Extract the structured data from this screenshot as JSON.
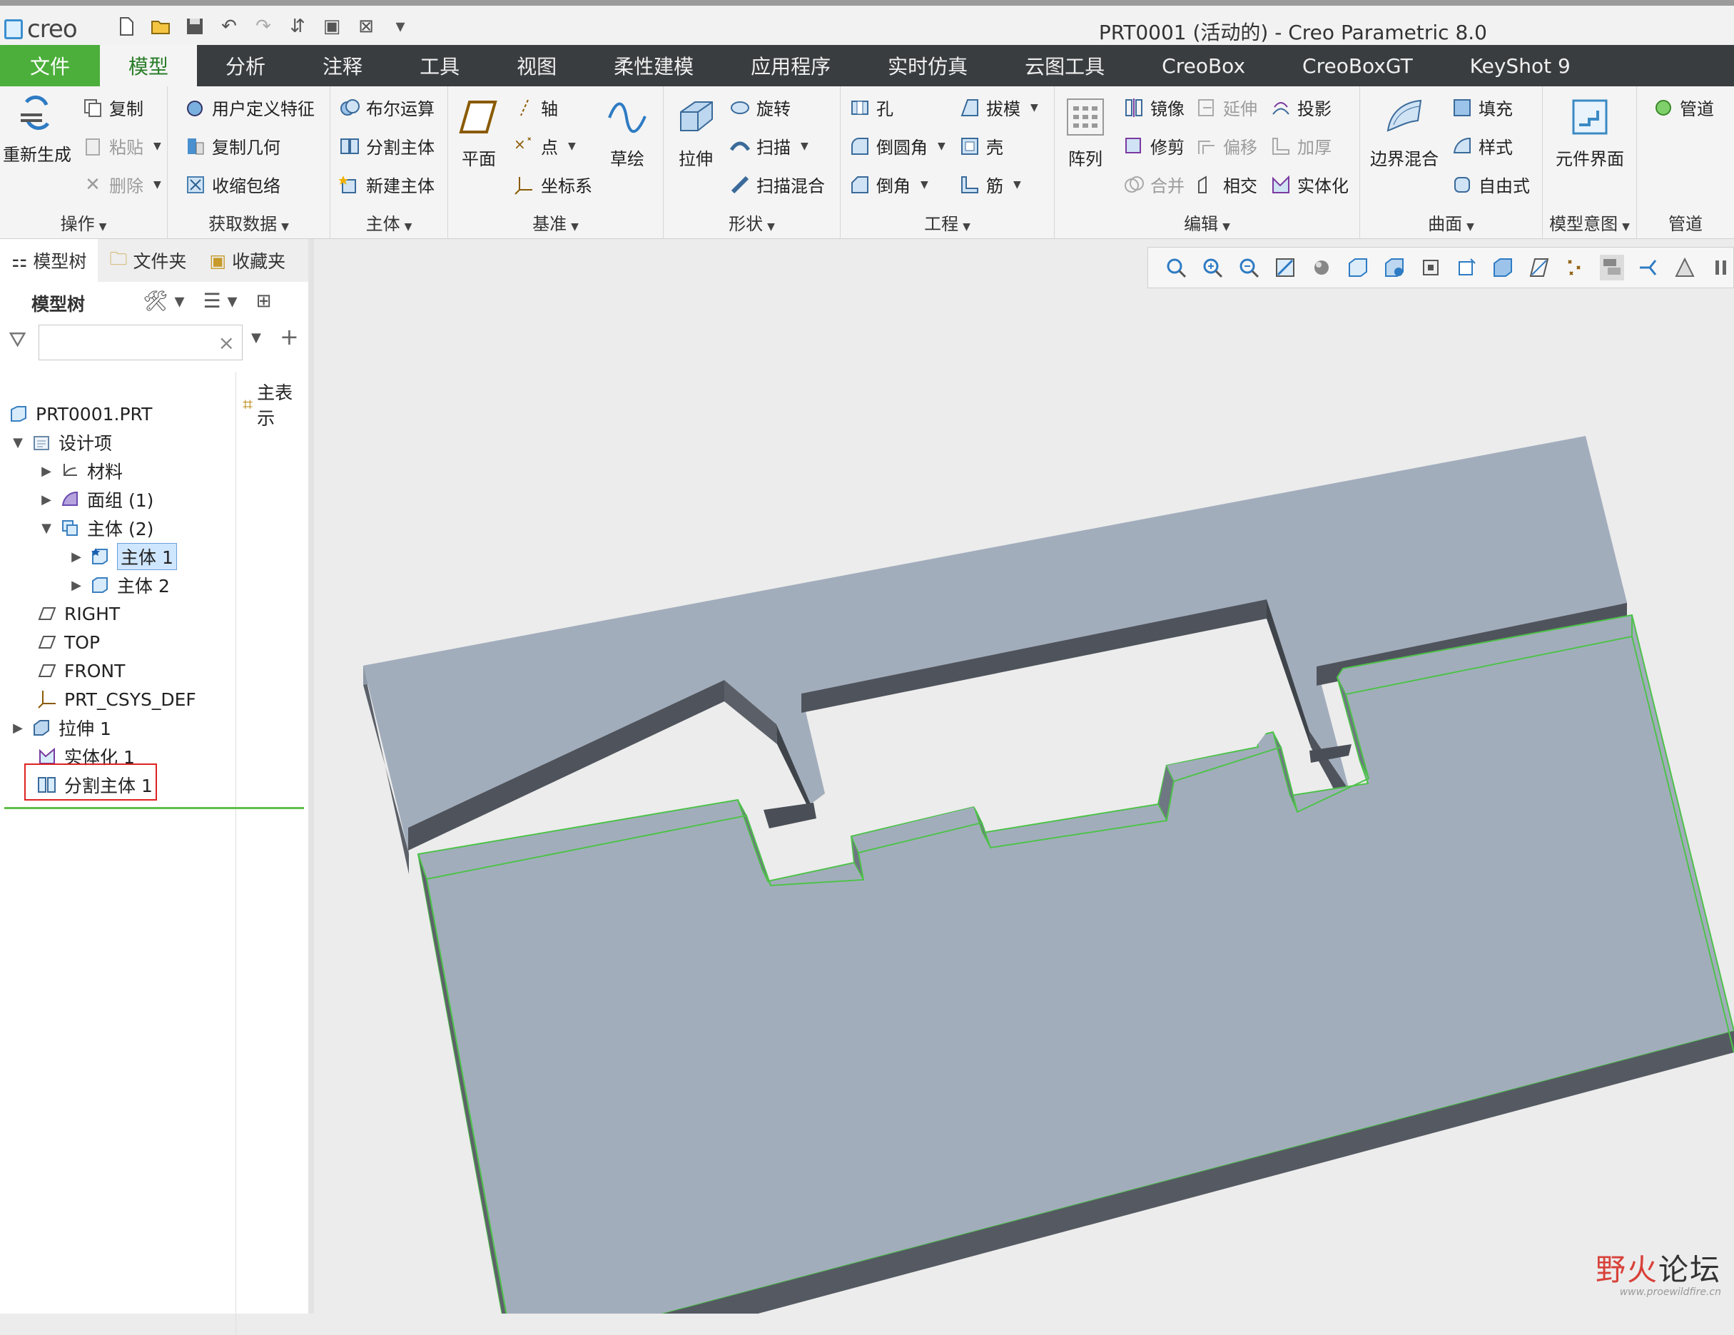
{
  "app": {
    "logo_text": "creo",
    "window_title": "PRT0001 (活动的) - Creo Parametric 8.0"
  },
  "ribbon_tabs": [
    {
      "label": "文件"
    },
    {
      "label": "模型"
    },
    {
      "label": "分析"
    },
    {
      "label": "注释"
    },
    {
      "label": "工具"
    },
    {
      "label": "视图"
    },
    {
      "label": "柔性建模"
    },
    {
      "label": "应用程序"
    },
    {
      "label": "实时仿真"
    },
    {
      "label": "云图工具"
    },
    {
      "label": "CreoBox"
    },
    {
      "label": "CreoBoxGT"
    },
    {
      "label": "KeyShot 9"
    }
  ],
  "groups": {
    "operations": {
      "title": "操作",
      "regenerate": "重新生成",
      "copy": "复制",
      "paste": "粘贴",
      "delete": "删除"
    },
    "get_data": {
      "title": "获取数据",
      "udf": "用户定义特征",
      "copy_geom": "复制几何",
      "shrinkwrap": "收缩包络"
    },
    "body": {
      "title": "主体",
      "boolean": "布尔运算",
      "split": "分割主体",
      "new_body": "新建主体"
    },
    "datum": {
      "title": "基准",
      "plane": "平面",
      "axis": "轴",
      "point": "点",
      "csys": "坐标系",
      "sketch": "草绘"
    },
    "shapes": {
      "title": "形状",
      "extrude": "拉伸",
      "revolve": "旋转",
      "sweep": "扫描",
      "swept_blend": "扫描混合"
    },
    "engineering": {
      "title": "工程",
      "hole": "孔",
      "round": "倒圆角",
      "chamfer": "倒角",
      "draft": "拔模",
      "shell": "壳",
      "rib": "筋"
    },
    "editing": {
      "title": "编辑",
      "pattern": "阵列",
      "mirror": "镜像",
      "trim": "修剪",
      "merge": "合并",
      "extend": "延伸",
      "offset": "偏移",
      "intersect": "相交",
      "project": "投影",
      "thicken": "加厚",
      "solidify": "实体化"
    },
    "surfaces": {
      "title": "曲面",
      "boundary_blend": "边界混合",
      "fill": "填充",
      "style": "样式",
      "freestyle": "自由式"
    },
    "model_intent": {
      "title": "模型意图",
      "component_interface": "元件界面"
    },
    "piping": {
      "title": "管道",
      "pipe": "管道"
    }
  },
  "panel": {
    "tabs": [
      {
        "label": "模型树"
      },
      {
        "label": "文件夹"
      },
      {
        "label": "收藏夹"
      }
    ],
    "tree_title": "模型树",
    "search_value": "",
    "column_header": "主表示",
    "tree": [
      {
        "label": "PRT0001.PRT",
        "icon": "part-icon"
      },
      {
        "label": "设计项",
        "icon": "design-items-icon",
        "expanded": true
      },
      {
        "label": "材料",
        "icon": "material-icon",
        "expanded": false
      },
      {
        "label": "面组 (1)",
        "icon": "quilt-icon",
        "expanded": false
      },
      {
        "label": "主体 (2)",
        "icon": "bodies-icon",
        "expanded": true
      },
      {
        "label": "主体 1",
        "icon": "body-icon",
        "expanded": false,
        "selected": true
      },
      {
        "label": "主体 2",
        "icon": "body-icon",
        "expanded": false
      },
      {
        "label": "RIGHT",
        "icon": "datum-plane-icon"
      },
      {
        "label": "TOP",
        "icon": "datum-plane-icon"
      },
      {
        "label": "FRONT",
        "icon": "datum-plane-icon"
      },
      {
        "label": "PRT_CSYS_DEF",
        "icon": "csys-icon"
      },
      {
        "label": "拉伸 1",
        "icon": "extrude-icon",
        "expanded": false
      },
      {
        "label": "实体化 1",
        "icon": "solidify-icon"
      },
      {
        "label": "分割主体 1",
        "icon": "split-body-icon",
        "highlighted": true
      }
    ]
  },
  "watermark": {
    "text_a": "野",
    "text_b": "火",
    "text_c": "论坛",
    "url": "www.proewildfire.cn"
  },
  "colors": {
    "file_tab": "#4caf3b",
    "active_tab_text": "#2a7d2a",
    "tab_bar": "#3a3d40",
    "body_top": "#a2adbc",
    "body_side": "#545961",
    "edge_highlight": "#4ec24a",
    "annotation_red": "#dd2222"
  }
}
